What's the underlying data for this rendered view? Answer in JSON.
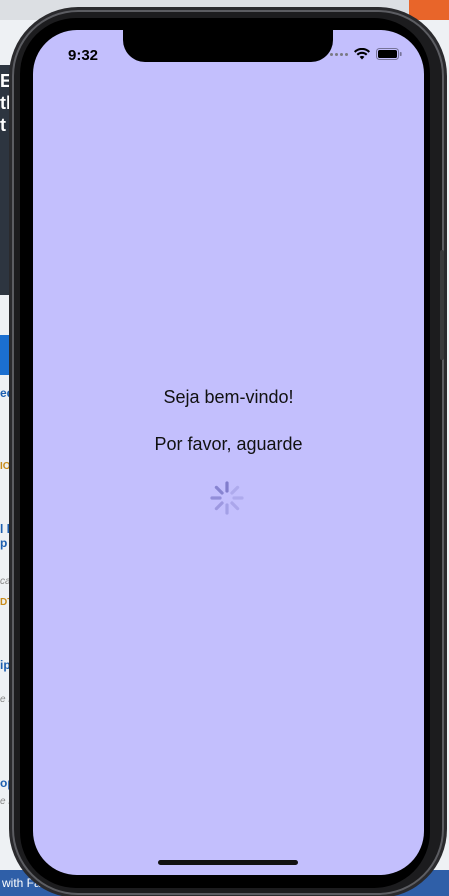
{
  "background_page": {
    "hero_text": "ES\ntl\nt",
    "links": [
      "ed",
      "l la\np",
      "ipl",
      "op"
    ],
    "orange_labels": [
      "IO",
      "DT"
    ],
    "gray_texts": [
      "ca",
      "e lo",
      "e lo"
    ],
    "footer_text": "with Fa"
  },
  "status_bar": {
    "time": "9:32"
  },
  "loading_screen": {
    "welcome_text": "Seja bem-vindo!",
    "wait_text": "Por favor, aguarde"
  },
  "colors": {
    "screen_background": "#c3bffd",
    "text": "#111111",
    "spinner": "#7d79c9"
  },
  "icons": {
    "wifi": "wifi-icon",
    "battery": "battery-icon",
    "cellular": "cellular-dots-icon",
    "spinner": "activity-spinner-icon"
  }
}
